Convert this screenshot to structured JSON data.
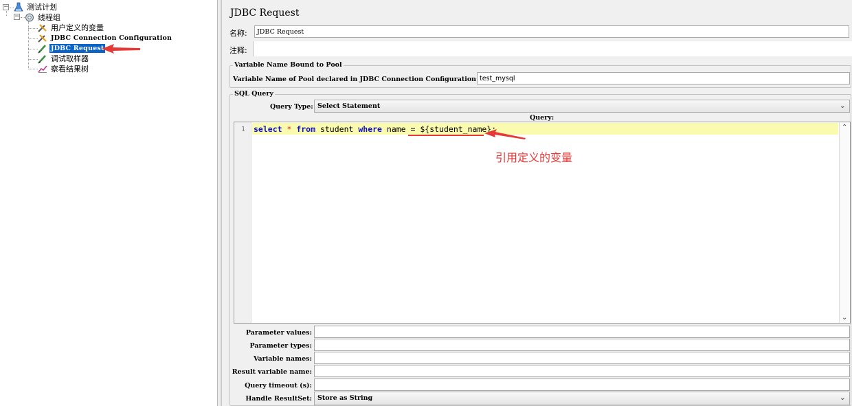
{
  "tree": {
    "test_plan": "测试计划",
    "thread_group": "线程组",
    "items": [
      {
        "label": "用户定义的变量",
        "icon": "wrench-icon"
      },
      {
        "label": "JDBC Connection Configuration",
        "icon": "wrench-icon"
      },
      {
        "label": "JDBC Request",
        "icon": "pencil-icon",
        "selected": true
      },
      {
        "label": "调试取样器",
        "icon": "pencil-icon"
      },
      {
        "label": "察看结果树",
        "icon": "chart-icon"
      }
    ]
  },
  "panel": {
    "title": "JDBC Request",
    "name_label": "名称:",
    "name_value": "JDBC Request",
    "comments_label": "注释:",
    "comments_value": "",
    "pool_group": "Variable Name Bound to Pool",
    "pool_label": "Variable Name of Pool declared in JDBC Connection Configuration:",
    "pool_value": "test_mysql",
    "sql_group": "SQL Query",
    "query_type_label": "Query Type:",
    "query_type_value": "Select Statement",
    "query_label": "Query:",
    "line_number": "1",
    "code": {
      "select": "select",
      "star": " * ",
      "from": "from",
      "table": " student ",
      "where": "where",
      "cond": " name = ",
      "var": "${student_name};"
    },
    "annotation": "引用定义的变量",
    "params": [
      {
        "label": "Parameter values:",
        "value": ""
      },
      {
        "label": "Parameter types:",
        "value": ""
      },
      {
        "label": "Variable names:",
        "value": ""
      },
      {
        "label": "Result variable name:",
        "value": ""
      },
      {
        "label": "Query timeout (s):",
        "value": ""
      }
    ],
    "resultset_label": "Handle ResultSet:",
    "resultset_value": "Store as String"
  },
  "colors": {
    "selection": "#0a64c8",
    "annotation": "#e53935",
    "keyword": "#1010c8",
    "line_highlight": "#fbfbb0"
  }
}
